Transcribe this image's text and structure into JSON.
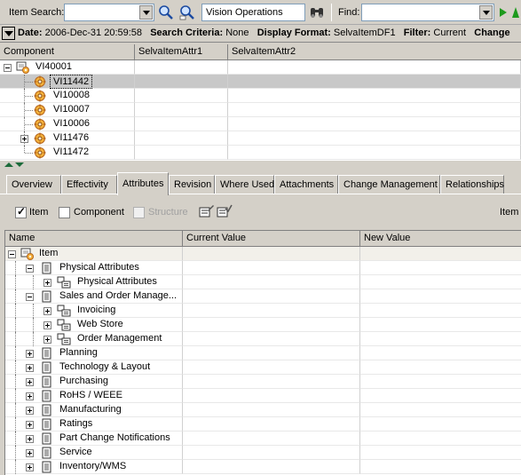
{
  "toolbar": {
    "item_search_label": "Item Search:",
    "item_search_value": "",
    "org_value": "Vision Operations",
    "find_label": "Find:",
    "find_value": ""
  },
  "infobar": {
    "date_label": "Date:",
    "date_value": "2006-Dec-31 20:59:58",
    "criteria_label": "Search Criteria:",
    "criteria_value": "None",
    "format_label": "Display Format:",
    "format_value": "SelvaItemDF1",
    "filter_label": "Filter:",
    "filter_value": "Current",
    "change_label": "Change"
  },
  "top_grid": {
    "columns": [
      "Component",
      "SelvaItemAttr1",
      "SelvaItemAttr2"
    ],
    "rows": [
      {
        "label": "VI40001",
        "level": 0,
        "expanded": true
      },
      {
        "label": "VI11442",
        "level": 1,
        "selected": true
      },
      {
        "label": "VI10008",
        "level": 1
      },
      {
        "label": "VI10007",
        "level": 1
      },
      {
        "label": "VI10006",
        "level": 1
      },
      {
        "label": "VI11476",
        "level": 1,
        "collapsed": true
      },
      {
        "label": "VI11472",
        "level": 1
      }
    ]
  },
  "tabs": [
    "Overview",
    "Effectivity",
    "Attributes",
    "Revision",
    "Where Used",
    "Attachments",
    "Change Management",
    "Relationships"
  ],
  "active_tab": "Attributes",
  "filters": {
    "item_label": "Item",
    "item_checked": true,
    "component_label": "Component",
    "component_checked": false,
    "structure_label": "Structure",
    "structure_enabled": false,
    "right_label": "Item"
  },
  "attr_grid": {
    "columns": [
      "Name",
      "Current Value",
      "New Value"
    ],
    "rows": [
      {
        "label": "Item",
        "level": 0,
        "type": "item"
      },
      {
        "label": "Physical Attributes",
        "level": 1,
        "type": "group",
        "expanded": true
      },
      {
        "label": "Physical Attributes",
        "level": 2,
        "type": "sub"
      },
      {
        "label": "Sales and Order Manage...",
        "level": 1,
        "type": "group",
        "expanded": true
      },
      {
        "label": "Invoicing",
        "level": 2,
        "type": "sub"
      },
      {
        "label": "Web Store",
        "level": 2,
        "type": "sub"
      },
      {
        "label": "Order Management",
        "level": 2,
        "type": "sub"
      },
      {
        "label": "Planning",
        "level": 1,
        "type": "group"
      },
      {
        "label": "Technology & Layout",
        "level": 1,
        "type": "group"
      },
      {
        "label": "Purchasing",
        "level": 1,
        "type": "group"
      },
      {
        "label": "RoHS / WEEE",
        "level": 1,
        "type": "group"
      },
      {
        "label": "Manufacturing",
        "level": 1,
        "type": "group"
      },
      {
        "label": "Ratings",
        "level": 1,
        "type": "group"
      },
      {
        "label": "Part Change Notifications",
        "level": 1,
        "type": "group"
      },
      {
        "label": "Service",
        "level": 1,
        "type": "group"
      },
      {
        "label": "Inventory/WMS",
        "level": 1,
        "type": "group"
      }
    ]
  }
}
